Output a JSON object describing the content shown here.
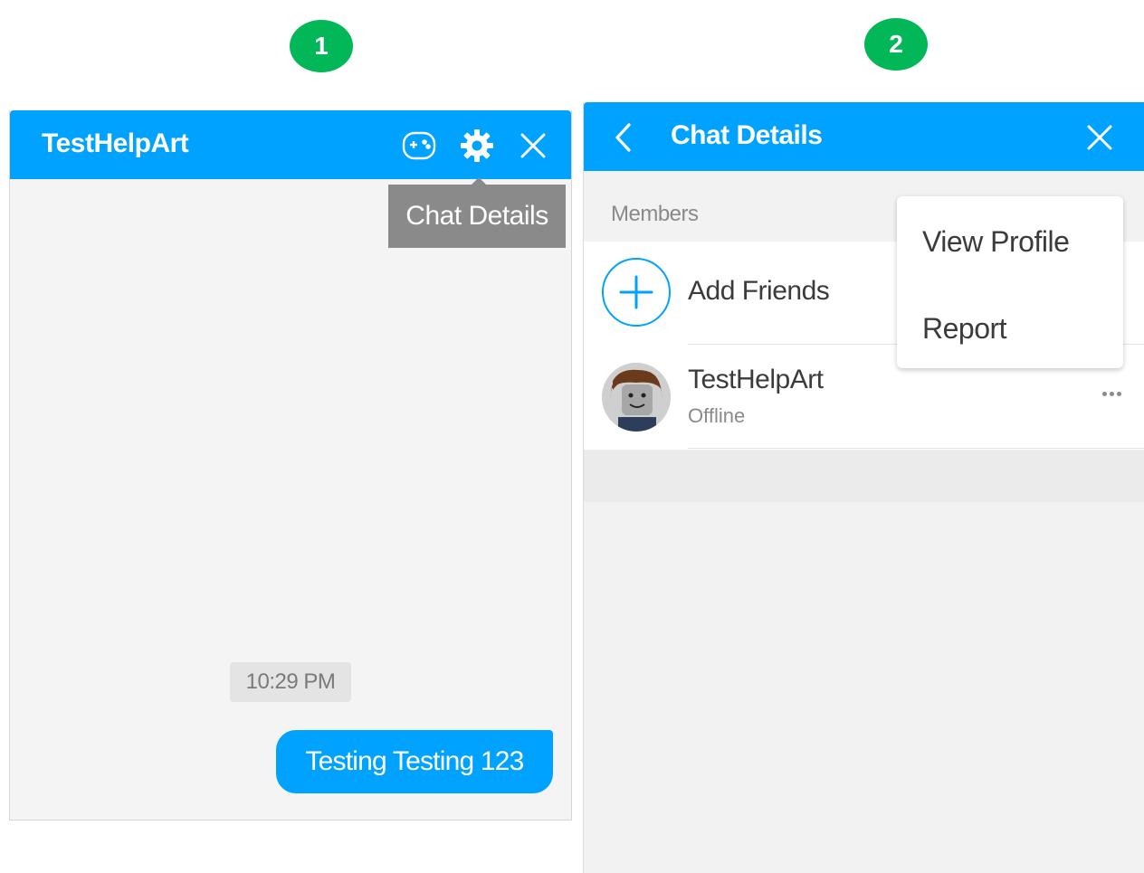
{
  "badges": {
    "step1": "1",
    "step2": "2"
  },
  "chat_window": {
    "title": "TestHelpArt",
    "header_icons": [
      "game-controller-icon",
      "gear-icon",
      "close-icon"
    ],
    "tooltip": "Chat Details",
    "timestamp": "10:29 PM",
    "message": "Testing Testing 123"
  },
  "details_panel": {
    "title": "Chat Details",
    "members_label": "Members",
    "add_friends_label": "Add Friends",
    "member": {
      "name": "TestHelpArt",
      "status": "Offline"
    },
    "menu": {
      "view_profile": "View Profile",
      "report": "Report"
    }
  },
  "colors": {
    "header_blue": "#00a2ff",
    "badge_green": "#02b757",
    "tooltip_gray": "#8a8a8a",
    "panel_bg": "#f4f4f4"
  }
}
